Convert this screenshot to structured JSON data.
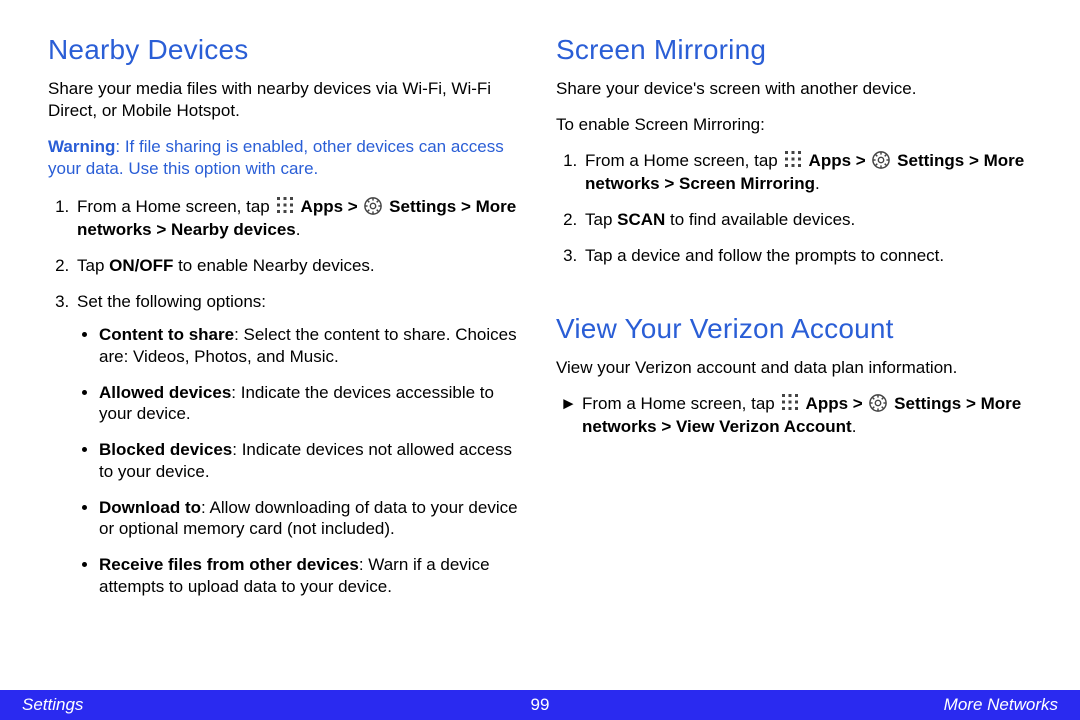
{
  "left": {
    "heading": "Nearby Devices",
    "intro": "Share your media files with nearby devices via Wi-Fi, Wi-Fi Direct, or Mobile Hotspot.",
    "warn_label": "Warning",
    "warn_text": ": If file sharing is enabled, other devices can access your data. Use this option with care.",
    "step1_pre": "From a Home screen, tap ",
    "step1_apps": " Apps > ",
    "step1_settings": " Settings > More networks > Nearby devices",
    "step1_post": ".",
    "step2_pre": "Tap ",
    "step2_b": "ON/OFF",
    "step2_post": " to enable Nearby devices.",
    "step3": "Set the following options:",
    "opt1_b": "Content to share",
    "opt1_t": ": Select the content to share. Choices are: Videos, Photos, and Music.",
    "opt2_b": "Allowed devices",
    "opt2_t": ": Indicate the devices accessible to your device.",
    "opt3_b": "Blocked devices",
    "opt3_t": ": Indicate devices not allowed access to your device.",
    "opt4_b": "Download to",
    "opt4_t": ": Allow downloading of data to your device or optional memory card (not included).",
    "opt5_b": "Receive files from other devices",
    "opt5_t": ": Warn if a device attempts to upload data to your device."
  },
  "right": {
    "h1": "Screen Mirroring",
    "p1": "Share your device's screen with another device.",
    "p2": "To enable Screen Mirroring:",
    "s1_pre": "From a Home screen, tap ",
    "s1_apps": " Apps > ",
    "s1_settings": " Settings > More networks > Screen Mirroring",
    "s1_post": ".",
    "s2_pre": "Tap ",
    "s2_b": "SCAN",
    "s2_post": " to find available devices.",
    "s3": "Tap a device and follow the prompts to connect.",
    "h2": "View Your Verizon Account",
    "p3": "View your Verizon account and data plan information.",
    "v_pre": "From a Home screen, tap ",
    "v_apps": " Apps > ",
    "v_settings": " Settings > More networks > View Verizon Account",
    "v_post": "."
  },
  "footer": {
    "left": "Settings",
    "page": "99",
    "right": "More Networks"
  }
}
